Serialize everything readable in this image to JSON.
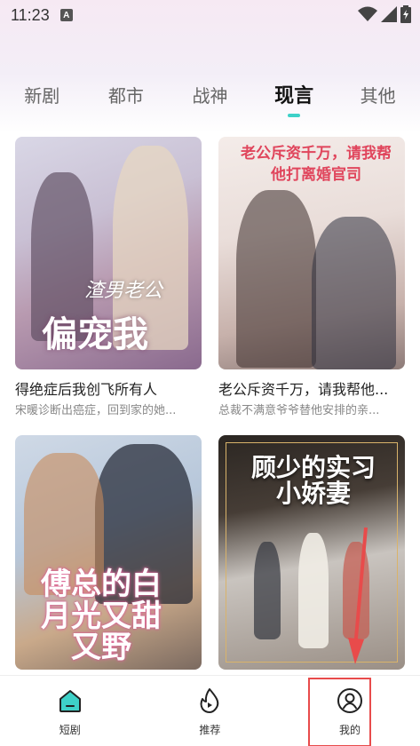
{
  "status_bar": {
    "time": "11:23",
    "notification_letter": "A"
  },
  "tabs": [
    {
      "label": "新剧",
      "active": false
    },
    {
      "label": "都市",
      "active": false
    },
    {
      "label": "战神",
      "active": false
    },
    {
      "label": "现言",
      "active": true
    },
    {
      "label": "其他",
      "active": false
    }
  ],
  "cards": [
    {
      "title": "得绝症后我创飞所有人",
      "desc": "宋暖诊断出癌症，回到家的她...",
      "poster_text": "偏宠我",
      "poster_sub": "渣男老公"
    },
    {
      "title": "老公斥资千万，请我帮他...",
      "desc": "总裁不满意爷爷替他安排的亲...",
      "poster_text": "老公斥资千万，请我帮他打离婚官司"
    },
    {
      "title": "",
      "desc": "",
      "poster_text": "傅总的白月光又甜又野"
    },
    {
      "title": "",
      "desc": "",
      "poster_text": "顾少的实习小娇妻"
    }
  ],
  "bottom_nav": [
    {
      "label": "短剧",
      "icon": "home-icon"
    },
    {
      "label": "推荐",
      "icon": "flame-play-icon"
    },
    {
      "label": "我的",
      "icon": "user-circle-icon"
    }
  ],
  "colors": {
    "accent": "#3ed1c8",
    "highlight_box": "#e84b4b"
  }
}
